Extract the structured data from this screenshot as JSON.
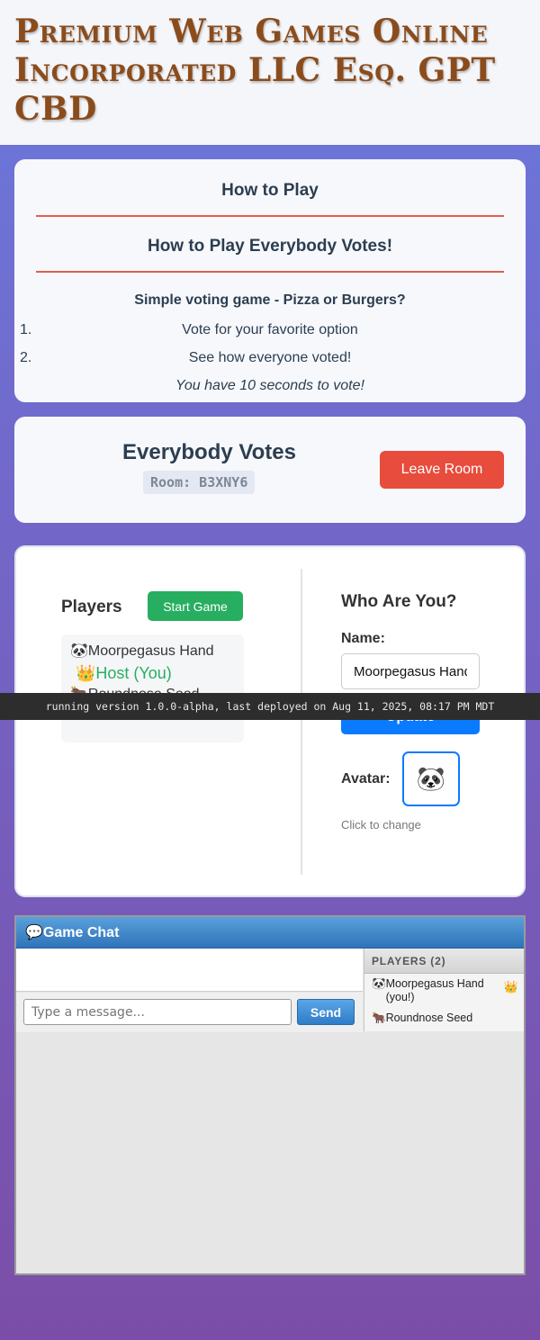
{
  "site": {
    "title": "Premium Web Games Online Incorporated LLC Esq. GPT CBD"
  },
  "howto": {
    "heading": "How to Play",
    "game_heading": "How to Play Everybody Votes!",
    "subtitle": "Simple voting game - Pizza or Burgers?",
    "steps": [
      {
        "num": "1.",
        "text": "Vote for your favorite option"
      },
      {
        "num": "2.",
        "text": "See how everyone voted!"
      }
    ],
    "note": "You have 10 seconds to vote!"
  },
  "room": {
    "game_title": "Everybody Votes",
    "room_code": "Room: B3XNY6",
    "leave_label": "Leave Room"
  },
  "lobby": {
    "players_title": "Players",
    "start_label": "Start Game",
    "players": [
      {
        "avatar": "🐼",
        "name": "Moorpegasus Hand",
        "crown": "👑",
        "host_label": "Host (You)"
      },
      {
        "avatar": "🐂",
        "name": "Roundnose Seed"
      }
    ],
    "who_title": "Who Are You?",
    "name_label": "Name:",
    "name_value": "Moorpegasus Hand",
    "update_label": "Update",
    "avatar_label": "Avatar:",
    "avatar_value": "🐼",
    "avatar_hint": "Click to change"
  },
  "version_banner": "running version 1.0.0-alpha, last deployed on Aug 11, 2025, 08:17 PM MDT",
  "chat": {
    "icon": "💬",
    "title": "Game Chat",
    "input_placeholder": "Type a message...",
    "send_label": "Send",
    "players_header": "PLAYERS (2)",
    "players": [
      {
        "avatar": "🐼",
        "name": "Moorpegasus Hand (you!)",
        "crown": "👑"
      },
      {
        "avatar": "🐂",
        "name": "Roundnose Seed"
      }
    ]
  },
  "colors": {
    "accent_red": "#e74c3c",
    "accent_green": "#27ae60",
    "accent_blue": "#0a7bff",
    "title_brown": "#8b4c1c"
  }
}
